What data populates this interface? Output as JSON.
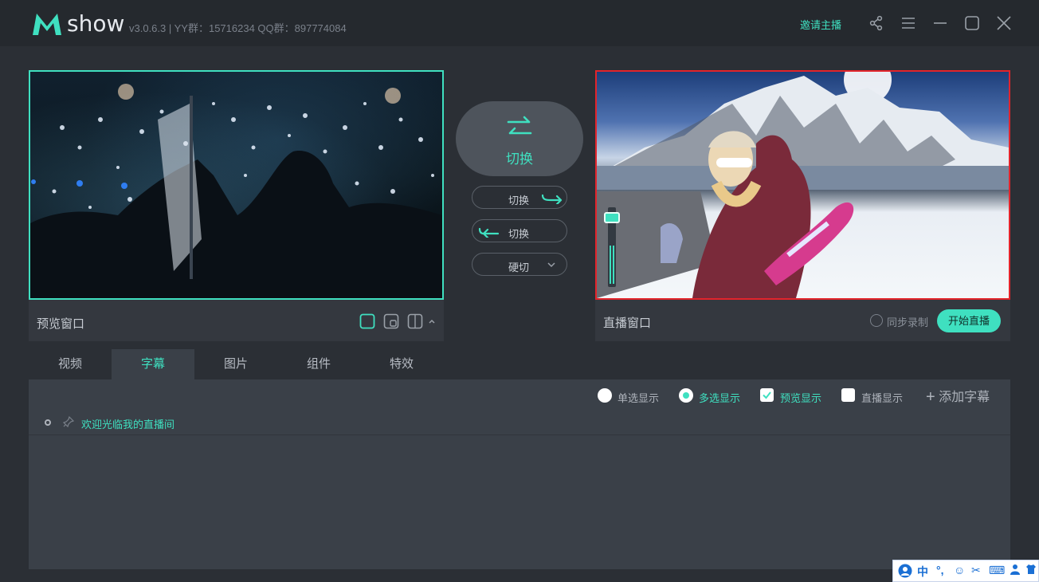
{
  "app": {
    "logo_text": "show",
    "version_info": "v3.0.6.3  |  YY群：15716234 QQ群：897774084",
    "invite_label": "邀请主播",
    "window_icons": [
      "share-icon",
      "menu-icon",
      "minimize-icon",
      "maximize-icon",
      "close-icon"
    ]
  },
  "preview": {
    "label": "预览窗口",
    "layout_icons": [
      "layout-single-icon",
      "layout-pip-icon",
      "layout-split-icon",
      "chevron-up-icon"
    ]
  },
  "live": {
    "label": "直播窗口",
    "sync_record_label": "同步录制",
    "start_live_label": "开始直播"
  },
  "switch": {
    "main_label": "切换",
    "to_live_label": "切换",
    "to_preview_label": "切换",
    "hard_cut_label": "硬切"
  },
  "tabs": [
    "视频",
    "字幕",
    "图片",
    "组件",
    "特效"
  ],
  "active_tab": "字幕",
  "subtitles": {
    "options": {
      "single": "单选显示",
      "multi": "多选显示",
      "preview": "预览显示",
      "live": "直播显示"
    },
    "add_label": "添加字幕",
    "items": [
      "欢迎光临我的直播间"
    ]
  },
  "ime": {
    "items": [
      "中",
      "°,",
      "☺",
      "✂",
      "⌨",
      "👤",
      "👕"
    ]
  },
  "colors": {
    "accent": "#3fe0c0",
    "live_border": "#e3242b",
    "background": "#2b2f35"
  }
}
